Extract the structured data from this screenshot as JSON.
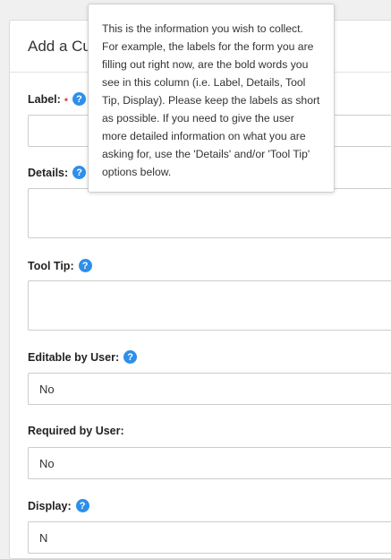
{
  "form": {
    "title": "Add a Cus",
    "fields": {
      "label": {
        "label": "Label:",
        "required_marker": "•"
      },
      "details": {
        "label": "Details:"
      },
      "tooltip": {
        "label": "Tool Tip:"
      },
      "editable": {
        "label": "Editable by User:",
        "value": "No"
      },
      "required": {
        "label": "Required by User:",
        "value": "No"
      },
      "display": {
        "label": "Display:",
        "value": "N"
      }
    }
  },
  "help_icon_text": "?",
  "popover": {
    "text": "This is the information you wish to collect. For example, the labels for the form you are filling out right now, are the bold words you see in this column (i.e. Label, Details, Tool Tip, Display). Please keep the labels as short as possible. If you need to give the user more detailed information on what you are asking for, use the 'Details' and/or 'Tool Tip' options below."
  },
  "colors": {
    "help_icon": "#2e8fea",
    "required_marker": "#d9534f"
  }
}
